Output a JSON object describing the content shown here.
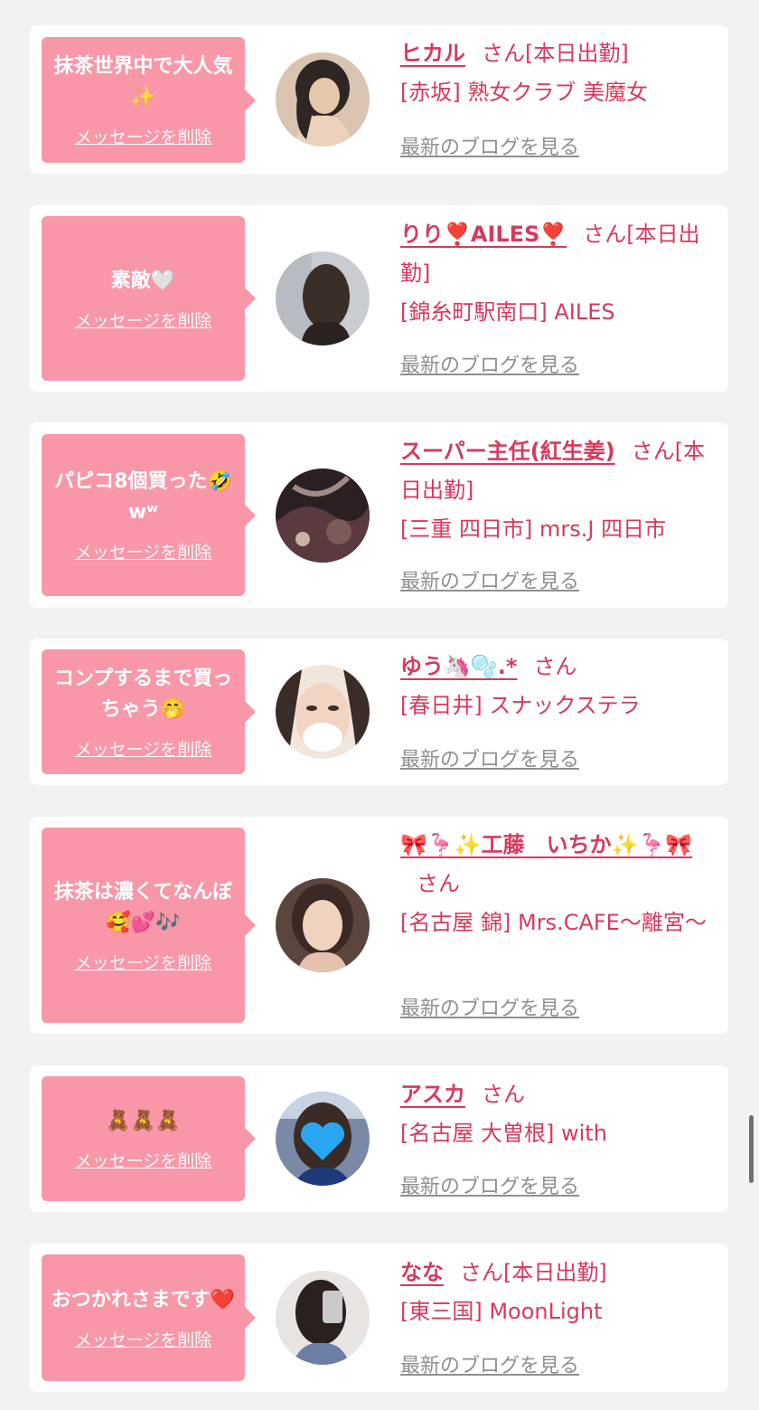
{
  "colors": {
    "background": "#f2f2f2",
    "card": "#ffffff",
    "bubble": "#f797a8",
    "accent_text": "#d63a5c",
    "link_gray": "#8f8f8f"
  },
  "delete_label": "メッセージを削除",
  "blog_label": "最新のブログを見る",
  "cards": [
    {
      "message": "抹茶世界中で大人気✨",
      "name": "ヒカル",
      "san": "さん[本日出勤]",
      "shop": "[赤坂] 熟女クラブ 美魔女",
      "avatar_icon": "woman-dark-hair-photo"
    },
    {
      "message": "素敵🤍",
      "name": "りり❣️AILES❣️",
      "san": "さん[本日出勤]",
      "shop": "[錦糸町駅南口] AILES",
      "avatar_icon": "woman-back-hair-photo"
    },
    {
      "message": "パピコ8個買った🤣wʷ",
      "name": "スーパー主任(紅生姜)",
      "san": "さん[本日出勤]",
      "shop": "[三重 四日市] mrs.J 四日市",
      "avatar_icon": "dark-abstract-photo"
    },
    {
      "message": "コンプするまで買っちゃう🤭",
      "name": "ゆう🦄🫧.*",
      "san": "さん",
      "shop": "[春日井] スナックステラ",
      "avatar_icon": "woman-face-blurred-photo"
    },
    {
      "message": "抹茶は濃くてなんぼ🥰💕🎶",
      "name": "🎀🦩✨工藤　いちか✨🦩🎀",
      "san": "さん",
      "shop": "[名古屋 錦] Mrs.CAFE～離宮～",
      "avatar_icon": "woman-smiling-photo"
    },
    {
      "message": "🧸🧸🧸",
      "name": "アスカ",
      "san": "さん",
      "shop": "[名古屋 大曽根] with",
      "avatar_icon": "woman-heart-covered-photo"
    },
    {
      "message": "おつかれさまです❤️",
      "name": "なな",
      "san": "さん[本日出勤]",
      "shop": "[東三国] MoonLight",
      "avatar_icon": "woman-mirror-selfie-photo"
    }
  ]
}
